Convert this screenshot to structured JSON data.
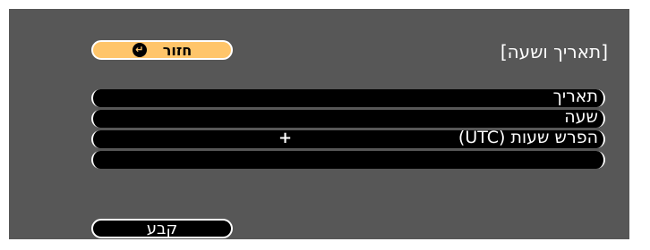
{
  "dialog": {
    "title": "[תאריך ושעה]",
    "back_label": "חזור",
    "back_icon": "return-icon"
  },
  "rows": [
    {
      "label": "תאריך",
      "value": ""
    },
    {
      "label": "שעה",
      "value": ""
    },
    {
      "label": "הפרש שעות (UTC)",
      "value": "+"
    },
    {
      "label": "",
      "value": ""
    }
  ],
  "set_button": {
    "label": "קבע"
  },
  "colors": {
    "background": "#575757",
    "accent": "#ffc56a",
    "row_bg": "#000000",
    "text": "#ffffff"
  }
}
